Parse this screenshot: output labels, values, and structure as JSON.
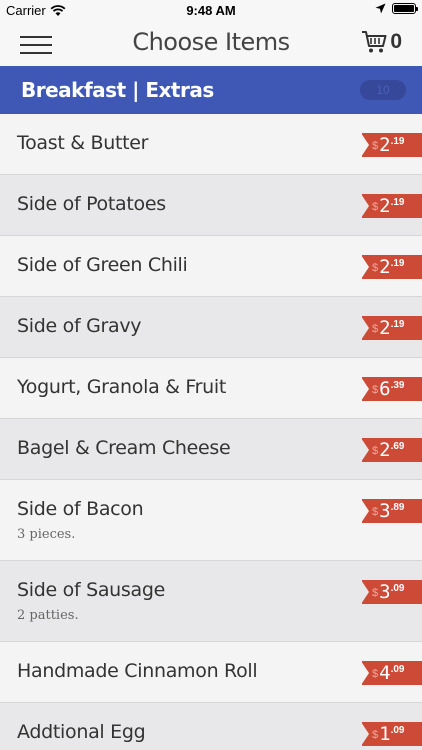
{
  "status_bar": {
    "carrier": "Carrier",
    "time": "9:48 AM"
  },
  "nav": {
    "title": "Choose Items",
    "cart_count": "0"
  },
  "section": {
    "title": "Breakfast | Extras",
    "badge": "10"
  },
  "colors": {
    "header_blue": "#3f58b5",
    "price_red": "#cc4a36"
  },
  "items": [
    {
      "name": "Toast & Butter",
      "desc": "",
      "currency": "$",
      "dollars": "2",
      "cents": ".19"
    },
    {
      "name": "Side of Potatoes",
      "desc": "",
      "currency": "$",
      "dollars": "2",
      "cents": ".19"
    },
    {
      "name": "Side of Green Chili",
      "desc": "",
      "currency": "$",
      "dollars": "2",
      "cents": ".19"
    },
    {
      "name": "Side of Gravy",
      "desc": "",
      "currency": "$",
      "dollars": "2",
      "cents": ".19"
    },
    {
      "name": "Yogurt, Granola & Fruit",
      "desc": "",
      "currency": "$",
      "dollars": "6",
      "cents": ".39"
    },
    {
      "name": "Bagel & Cream Cheese",
      "desc": "",
      "currency": "$",
      "dollars": "2",
      "cents": ".69"
    },
    {
      "name": "Side of Bacon",
      "desc": "3 pieces.",
      "currency": "$",
      "dollars": "3",
      "cents": ".89"
    },
    {
      "name": "Side of Sausage",
      "desc": "2 patties.",
      "currency": "$",
      "dollars": "3",
      "cents": ".09"
    },
    {
      "name": "Handmade Cinnamon Roll",
      "desc": "",
      "currency": "$",
      "dollars": "4",
      "cents": ".09"
    },
    {
      "name": "Addtional Egg",
      "desc": "",
      "currency": "$",
      "dollars": "1",
      "cents": ".09"
    }
  ]
}
